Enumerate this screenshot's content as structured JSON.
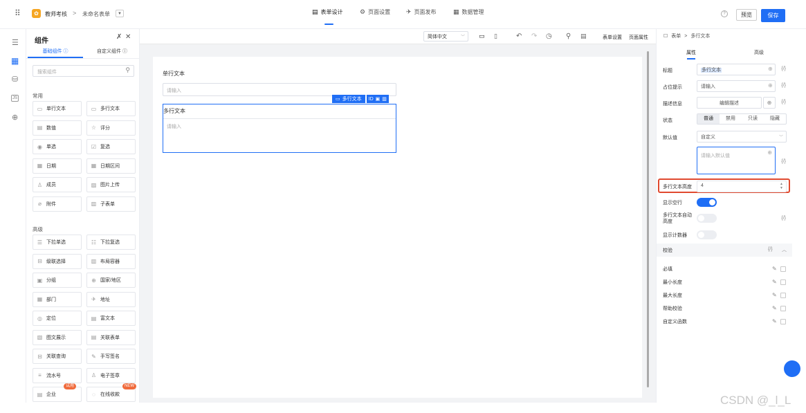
{
  "topbar": {
    "app_name": "教师考核",
    "breadcrumb_sep": ">",
    "form_name": "未命名表单",
    "tabs": [
      {
        "label": "表单设计",
        "active": true
      },
      {
        "label": "页面设置",
        "active": false
      },
      {
        "label": "页面发布",
        "active": false
      },
      {
        "label": "数据管理",
        "active": false
      }
    ],
    "preview_label": "预览",
    "save_label": "保存",
    "accent": "#1f6ef5"
  },
  "panel": {
    "title": "组件",
    "tabs": [
      "基础组件",
      "自定义组件"
    ],
    "search_placeholder": "搜索组件",
    "sections": [
      {
        "title": "常用",
        "items": [
          {
            "label": "单行文本",
            "icon": "▭"
          },
          {
            "label": "多行文本",
            "icon": "▭"
          },
          {
            "label": "数值",
            "icon": "▤"
          },
          {
            "label": "评分",
            "icon": "☆"
          },
          {
            "label": "单选",
            "icon": "◉"
          },
          {
            "label": "复选",
            "icon": "☑"
          },
          {
            "label": "日期",
            "icon": "▦"
          },
          {
            "label": "日期区间",
            "icon": "▦"
          },
          {
            "label": "成员",
            "icon": "♙"
          },
          {
            "label": "图片上传",
            "icon": "▨"
          },
          {
            "label": "附件",
            "icon": "⌀"
          },
          {
            "label": "子表单",
            "icon": "▥"
          }
        ]
      },
      {
        "title": "高级",
        "items": [
          {
            "label": "下拉单选",
            "icon": "☰"
          },
          {
            "label": "下拉复选",
            "icon": "☷"
          },
          {
            "label": "级联选择",
            "icon": "⊟"
          },
          {
            "label": "布局容器",
            "icon": "▥"
          },
          {
            "label": "分组",
            "icon": "▣"
          },
          {
            "label": "国家/地区",
            "icon": "⊕"
          },
          {
            "label": "部门",
            "icon": "▦"
          },
          {
            "label": "地址",
            "icon": "✈"
          },
          {
            "label": "定位",
            "icon": "◎"
          },
          {
            "label": "富文本",
            "icon": "▤"
          },
          {
            "label": "图文展示",
            "icon": "▧"
          },
          {
            "label": "关联表单",
            "icon": "▤"
          },
          {
            "label": "关联查询",
            "icon": "⊟"
          },
          {
            "label": "手写签名",
            "icon": "✎"
          },
          {
            "label": "流水号",
            "icon": "≡"
          },
          {
            "label": "电子签章",
            "icon": "♙"
          },
          {
            "label": "企业",
            "icon": "▤",
            "badge": "试用"
          },
          {
            "label": "在线收款",
            "icon": "◌",
            "badge": "NEW"
          }
        ]
      }
    ]
  },
  "toolbar": {
    "lang_select": "简体中文",
    "form_settings": "表单设置",
    "page_props": "页面属性"
  },
  "form": {
    "field1": {
      "label": "单行文本",
      "placeholder": "请输入"
    },
    "field2": {
      "label": "多行文本",
      "placeholder": "请输入",
      "tag": "多行文本",
      "tag_id": "ID"
    }
  },
  "props": {
    "crumb_root": "表单",
    "crumb_sep": ">",
    "crumb_current": "多行文本",
    "tabs": [
      "属性",
      "高级"
    ],
    "title_label": "标题",
    "title_value": "多行文本",
    "placeholder_label": "占位提示",
    "placeholder_value": "请输入",
    "desc_label": "描述信息",
    "desc_button": "编辑描述",
    "state_label": "状态",
    "states": [
      "普通",
      "禁用",
      "只读",
      "隐藏"
    ],
    "default_label": "默认值",
    "default_select": "自定义",
    "default_placeholder": "请输入默认值",
    "height_label": "多行文本高度",
    "height_value": "4",
    "show_empty_label": "显示空行",
    "show_empty": true,
    "auto_height_label": "多行文本自动高度",
    "auto_height": false,
    "counter_label": "显示计数器",
    "counter": false,
    "validation_label": "校验",
    "rules": [
      "必填",
      "最小长度",
      "最大长度",
      "帮助校验",
      "自定义函数"
    ],
    "fx": "{/}"
  },
  "watermark": "CSDN @_l_L"
}
